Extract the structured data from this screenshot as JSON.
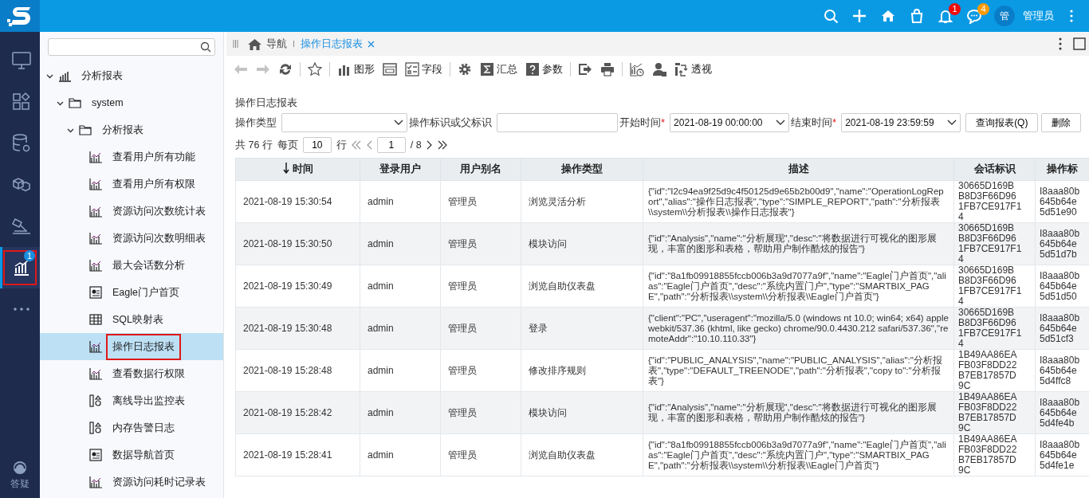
{
  "top_bar": {
    "actions": [
      {
        "kind": "search"
      },
      {
        "kind": "add"
      },
      {
        "kind": "home"
      },
      {
        "kind": "bag"
      },
      {
        "kind": "bell",
        "badge": "1",
        "color": "#f00a0a"
      },
      {
        "kind": "chat",
        "badge": "4",
        "color": "#ff9a00"
      }
    ],
    "user": {
      "avatar": "管",
      "name": "管理员"
    }
  },
  "rail": {
    "items": [
      {
        "kind": "monitor",
        "selected": false,
        "marked": false
      },
      {
        "kind": "apps",
        "selected": false,
        "marked": false
      },
      {
        "kind": "database",
        "selected": false,
        "marked": false
      },
      {
        "kind": "cubes",
        "selected": false,
        "marked": false
      },
      {
        "kind": "hammer",
        "selected": false,
        "marked": false
      },
      {
        "kind": "analysis",
        "selected": true,
        "marked": true,
        "badge": "1"
      },
      {
        "kind": "more",
        "selected": false,
        "marked": false
      }
    ],
    "help": {
      "label": "答疑"
    }
  },
  "tree": {
    "nodes": [
      {
        "label": "分析报表",
        "kind": "analysis",
        "expanded": true,
        "children": [
          {
            "label": "system",
            "kind": "folder",
            "expanded": true,
            "children": [
              {
                "label": "分析报表",
                "kind": "folder",
                "expanded": true,
                "children": [
                  {
                    "label": "查看用户所有功能",
                    "kind": "chart",
                    "selected": false,
                    "marked": false
                  },
                  {
                    "label": "查看用户所有权限",
                    "kind": "chart",
                    "selected": false,
                    "marked": false
                  },
                  {
                    "label": "资源访问次数统计表",
                    "kind": "chart",
                    "selected": false,
                    "marked": false
                  },
                  {
                    "label": "资源访问次数明细表",
                    "kind": "chart",
                    "selected": false,
                    "marked": false
                  },
                  {
                    "label": "最大会话数分析",
                    "kind": "chart",
                    "selected": false,
                    "marked": false
                  },
                  {
                    "label": "Eagle门户首页",
                    "kind": "portal",
                    "selected": false,
                    "marked": false
                  },
                  {
                    "label": "SQL映射表",
                    "kind": "table",
                    "selected": false,
                    "marked": false
                  },
                  {
                    "label": "操作日志报表",
                    "kind": "chart",
                    "selected": true,
                    "marked": true
                  },
                  {
                    "label": "查看数据行权限",
                    "kind": "chart",
                    "selected": false,
                    "marked": false
                  },
                  {
                    "label": "离线导出监控表",
                    "kind": "monitor",
                    "selected": false,
                    "marked": false
                  },
                  {
                    "label": "内存告警日志",
                    "kind": "monitor",
                    "selected": false,
                    "marked": false
                  },
                  {
                    "label": "数据导航首页",
                    "kind": "portal",
                    "selected": false,
                    "marked": false
                  },
                  {
                    "label": "资源访问耗时记录表",
                    "kind": "chart",
                    "selected": false,
                    "marked": false
                  }
                ]
              }
            ]
          }
        ]
      }
    ]
  },
  "tabs": [
    {
      "label": "导航",
      "kind": "home",
      "selected": false
    },
    {
      "label": "操作日志报表",
      "kind": "report",
      "selected": true
    }
  ],
  "toolbar": [
    {
      "kind": "back",
      "disabled": true
    },
    {
      "kind": "forward",
      "disabled": true
    },
    {
      "kind": "refresh",
      "disabled": false
    },
    {
      "kind": "separator"
    },
    {
      "kind": "star",
      "disabled": false
    },
    {
      "kind": "separator"
    },
    {
      "kind": "chart",
      "label": "图形",
      "disabled": false
    },
    {
      "kind": "layout",
      "disabled": false
    },
    {
      "kind": "fields",
      "label": "字段",
      "disabled": false
    },
    {
      "kind": "separator"
    },
    {
      "kind": "gear",
      "disabled": false
    },
    {
      "kind": "sum",
      "label": "汇总",
      "disabled": false
    },
    {
      "kind": "help",
      "label": "参数",
      "disabled": false
    },
    {
      "kind": "separator"
    },
    {
      "kind": "export",
      "disabled": false
    },
    {
      "kind": "print",
      "disabled": false
    },
    {
      "kind": "separator"
    },
    {
      "kind": "schedule",
      "disabled": false
    },
    {
      "kind": "user",
      "disabled": false
    },
    {
      "kind": "pivot",
      "label": "透视",
      "disabled": false
    }
  ],
  "report": {
    "title": "操作日志报表",
    "filters": [
      {
        "label": "操作类型",
        "kind": "select"
      },
      {
        "label": "操作标识或父标识",
        "kind": "text"
      },
      {
        "label": "开始时间",
        "kind": "select",
        "required_mark": "*",
        "value": "2021-08-19 00:00:00"
      },
      {
        "label": "结束时间",
        "kind": "select",
        "required_mark": "*",
        "value": "2021-08-19 23:59:59"
      }
    ],
    "buttons": [
      "查询报表(Q)",
      "删除"
    ],
    "pagination": {
      "total": "共 76 行",
      "per_page_label": "每页",
      "per_page": "10",
      "unit": "行",
      "page": "1",
      "pages": "/ 8"
    },
    "table": {
      "columns": [
        {
          "label": "时间",
          "sorted": true
        },
        {
          "label": "登录用户",
          "sorted": false
        },
        {
          "label": "用户别名",
          "sorted": false
        },
        {
          "label": "操作类型",
          "sorted": false
        },
        {
          "label": "描述",
          "sorted": false
        },
        {
          "label": "会话标识",
          "sorted": false
        },
        {
          "label": "操作标",
          "sorted": false
        }
      ],
      "rows": [
        {
          "time": "2021-08-19  15:30:54",
          "user": "admin",
          "alias": "管理员",
          "type": "浏览灵活分析",
          "desc": "{\"id\":\"I2c94ea9f25d9c4f50125d9e65b2b00d9\",\"name\":\"OperationLogReport\",\"alias\":\"操作日志报表\",\"type\":\"SIMPLE_REPORT\",\"path\":\"分析报表\\\\system\\\\分析报表\\\\操作日志报表\"}",
          "session": [
            "30665D169B",
            "B8D3F66D96",
            "1FB7CE917F1",
            "4"
          ],
          "op": [
            "I8aaa80b",
            "645b64e",
            "5d51e90"
          ]
        },
        {
          "time": "2021-08-19  15:30:50",
          "user": "admin",
          "alias": "管理员",
          "type": "模块访问",
          "desc": "{\"id\":\"Analysis\",\"name\":\"分析展现\",\"desc\":\"将数据进行可视化的图形展现，丰富的图形和表格，帮助用户制作酷炫的报告\"}",
          "session": [
            "30665D169B",
            "B8D3F66D96",
            "1FB7CE917F1",
            "4"
          ],
          "op": [
            "I8aaa80b",
            "645b64e",
            "5d51d7b"
          ]
        },
        {
          "time": "2021-08-19  15:30:49",
          "user": "admin",
          "alias": "管理员",
          "type": "浏览自助仪表盘",
          "desc": "{\"id\":\"8a1fb09918855fccb006b3a9d7077a9f\",\"name\":\"Eagle门户首页\",\"alias\":\"Eagle门户首页\",\"desc\":\"系统内置门户\",\"type\":\"SMARTBIX_PAGE\",\"path\":\"分析报表\\\\system\\\\分析报表\\\\Eagle门户首页\"}",
          "session": [
            "30665D169B",
            "B8D3F66D96",
            "1FB7CE917F1",
            "4"
          ],
          "op": [
            "I8aaa80b",
            "645b64e",
            "5d51d50"
          ]
        },
        {
          "time": "2021-08-19  15:30:48",
          "user": "admin",
          "alias": "管理员",
          "type": "登录",
          "desc": "{\"client\":\"PC\",\"useragent\":\"mozilla/5.0 (windows nt 10.0; win64; x64) applewebkit/537.36 (khtml, like gecko) chrome/90.0.4430.212 safari/537.36\",\"remoteAddr\":\"10.10.110.33\"}",
          "session": [
            "30665D169B",
            "B8D3F66D96",
            "1FB7CE917F1",
            "4"
          ],
          "op": [
            "I8aaa80b",
            "645b64e",
            "5d51cf3"
          ]
        },
        {
          "time": "2021-08-19  15:28:48",
          "user": "admin",
          "alias": "管理员",
          "type": "修改排序规则",
          "desc": "{\"id\":\"PUBLIC_ANALYSIS\",\"name\":\"PUBLIC_ANALYSIS\",\"alias\":\"分析报表\",\"type\":\"DEFAULT_TREENODE\",\"path\":\"分析报表\",\"copy to\":\"分析报表\"}",
          "session": [
            "1B49AA86EA",
            "FB03F8DD22",
            "B7EB17857D",
            "9C"
          ],
          "op": [
            "I8aaa80b",
            "645b64e",
            "5d4ffc8"
          ]
        },
        {
          "time": "2021-08-19  15:28:42",
          "user": "admin",
          "alias": "管理员",
          "type": "模块访问",
          "desc": "{\"id\":\"Analysis\",\"name\":\"分析展现\",\"desc\":\"将数据进行可视化的图形展现，丰富的图形和表格，帮助用户制作酷炫的报告\"}",
          "session": [
            "1B49AA86EA",
            "FB03F8DD22",
            "B7EB17857D",
            "9C"
          ],
          "op": [
            "I8aaa80b",
            "645b64e",
            "5d4fe4b"
          ]
        },
        {
          "time": "2021-08-19  15:28:41",
          "user": "admin",
          "alias": "管理员",
          "type": "浏览自助仪表盘",
          "desc": "{\"id\":\"8a1fb09918855fccb006b3a9d7077a9f\",\"name\":\"Eagle门户首页\",\"alias\":\"Eagle门户首页\",\"desc\":\"系统内置门户\",\"type\":\"SMARTBIX_PAGE\",\"path\":\"分析报表\\\\system\\\\分析报表\\\\Eagle门户首页\"}",
          "session": [
            "1B49AA86EA",
            "FB03F8DD22",
            "B7EB17857D",
            "9C"
          ],
          "op": [
            "I8aaa80b",
            "645b64e",
            "5d4fe1e"
          ]
        }
      ]
    }
  }
}
